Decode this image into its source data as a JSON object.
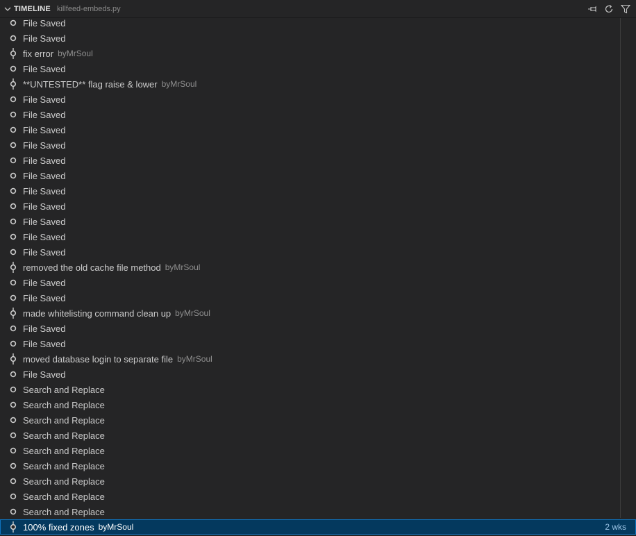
{
  "header": {
    "title": "TIMELINE",
    "file": "killfeed-embeds.py",
    "actions": [
      "pin-icon",
      "refresh-icon",
      "filter-icon"
    ]
  },
  "colors": {
    "background": "#252526",
    "selection": "#04395e",
    "selection_border": "#0e74c0",
    "text": "#cccccc",
    "description": "#8f8f8f"
  },
  "items": [
    {
      "type": "save",
      "label": "File Saved",
      "desc": ""
    },
    {
      "type": "save",
      "label": "File Saved",
      "desc": ""
    },
    {
      "type": "commit",
      "label": "fix error",
      "desc": "byMrSoul"
    },
    {
      "type": "save",
      "label": "File Saved",
      "desc": ""
    },
    {
      "type": "commit",
      "label": "**UNTESTED** flag raise & lower",
      "desc": "byMrSoul"
    },
    {
      "type": "save",
      "label": "File Saved",
      "desc": ""
    },
    {
      "type": "save",
      "label": "File Saved",
      "desc": ""
    },
    {
      "type": "save",
      "label": "File Saved",
      "desc": ""
    },
    {
      "type": "save",
      "label": "File Saved",
      "desc": ""
    },
    {
      "type": "save",
      "label": "File Saved",
      "desc": ""
    },
    {
      "type": "save",
      "label": "File Saved",
      "desc": ""
    },
    {
      "type": "save",
      "label": "File Saved",
      "desc": ""
    },
    {
      "type": "save",
      "label": "File Saved",
      "desc": ""
    },
    {
      "type": "save",
      "label": "File Saved",
      "desc": ""
    },
    {
      "type": "save",
      "label": "File Saved",
      "desc": ""
    },
    {
      "type": "save",
      "label": "File Saved",
      "desc": ""
    },
    {
      "type": "commit",
      "label": "removed the old cache file method",
      "desc": "byMrSoul"
    },
    {
      "type": "save",
      "label": "File Saved",
      "desc": ""
    },
    {
      "type": "save",
      "label": "File Saved",
      "desc": ""
    },
    {
      "type": "commit",
      "label": "made whitelisting command clean up",
      "desc": "byMrSoul"
    },
    {
      "type": "save",
      "label": "File Saved",
      "desc": ""
    },
    {
      "type": "save",
      "label": "File Saved",
      "desc": ""
    },
    {
      "type": "commit",
      "label": "moved database login to separate file",
      "desc": "byMrSoul"
    },
    {
      "type": "save",
      "label": "File Saved",
      "desc": ""
    },
    {
      "type": "save",
      "label": "Search and Replace",
      "desc": ""
    },
    {
      "type": "save",
      "label": "Search and Replace",
      "desc": ""
    },
    {
      "type": "save",
      "label": "Search and Replace",
      "desc": ""
    },
    {
      "type": "save",
      "label": "Search and Replace",
      "desc": ""
    },
    {
      "type": "save",
      "label": "Search and Replace",
      "desc": ""
    },
    {
      "type": "save",
      "label": "Search and Replace",
      "desc": ""
    },
    {
      "type": "save",
      "label": "Search and Replace",
      "desc": ""
    },
    {
      "type": "save",
      "label": "Search and Replace",
      "desc": ""
    },
    {
      "type": "save",
      "label": "Search and Replace",
      "desc": ""
    },
    {
      "type": "commit",
      "label": "100% fixed zones",
      "desc": "byMrSoul",
      "time": "2 wks",
      "selected": true
    }
  ]
}
